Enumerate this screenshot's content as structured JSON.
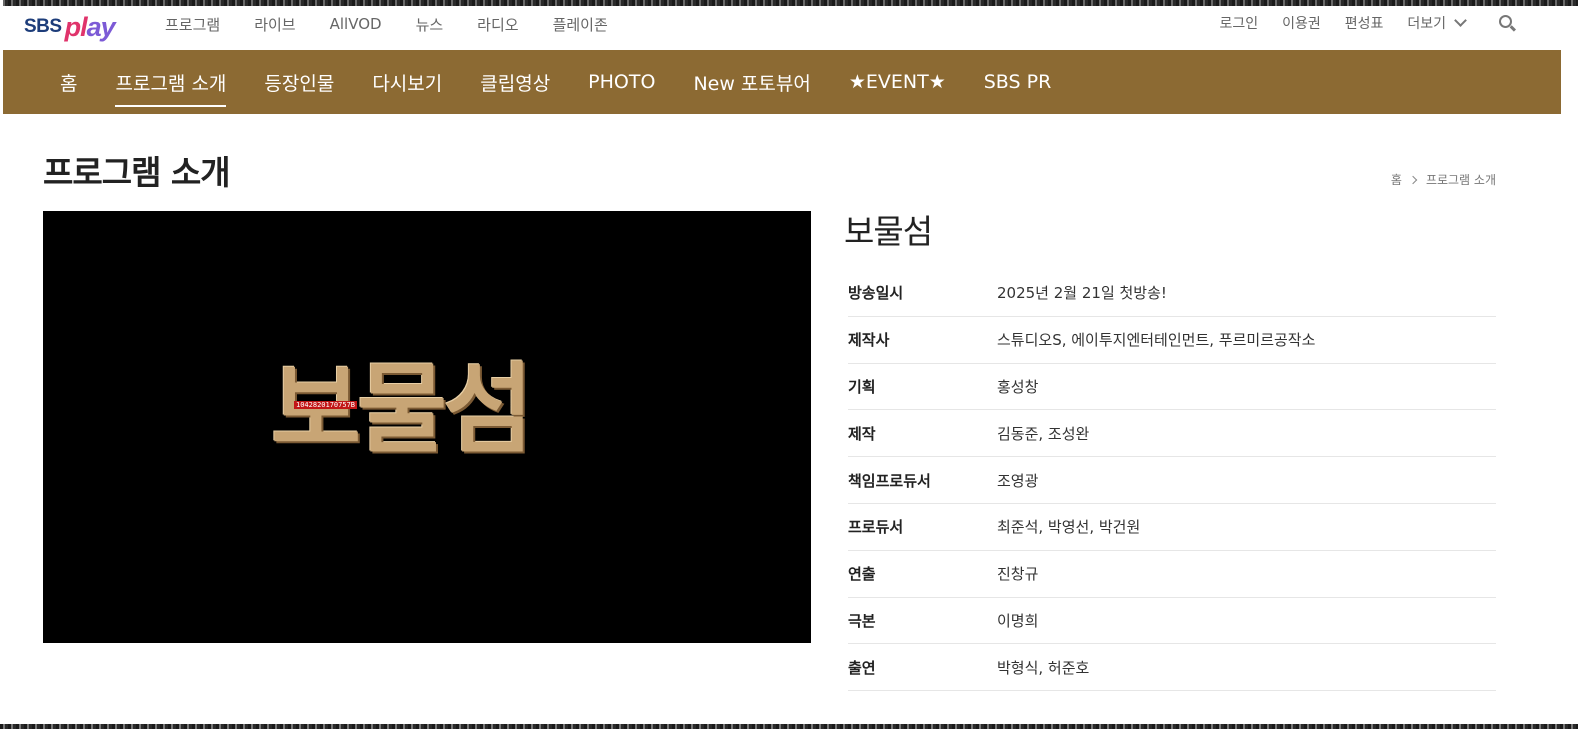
{
  "logo": {
    "sbs": "SBS",
    "play": [
      "p",
      "l",
      "a",
      "y"
    ]
  },
  "topnav": {
    "items": [
      "프로그램",
      "라이브",
      "AllVOD",
      "뉴스",
      "라디오",
      "플레이존"
    ]
  },
  "utility": {
    "login": "로그인",
    "subscription": "이용권",
    "schedule": "편성표",
    "more": "더보기"
  },
  "mainnav": {
    "items": [
      "홈",
      "프로그램 소개",
      "등장인물",
      "다시보기",
      "클립영상",
      "PHOTO",
      "New 포토뷰어",
      "★EVENT★",
      "SBS PR"
    ],
    "active_index": 1
  },
  "page": {
    "title": "프로그램 소개"
  },
  "breadcrumb": {
    "home": "홈",
    "current": "프로그램 소개"
  },
  "poster": {
    "title": "보물섬",
    "code": "1042820170757B"
  },
  "show": {
    "title": "보물섬",
    "info": [
      {
        "label": "방송일시",
        "value": "2025년 2월 21일 첫방송!"
      },
      {
        "label": "제작사",
        "value": "스튜디오S, 에이투지엔터테인먼트, 푸르미르공작소"
      },
      {
        "label": "기획",
        "value": "홍성창"
      },
      {
        "label": "제작",
        "value": "김동준, 조성완"
      },
      {
        "label": "책임프로듀서",
        "value": "조영광"
      },
      {
        "label": "프로듀서",
        "value": "최준석, 박영선, 박건원"
      },
      {
        "label": "연출",
        "value": "진창규"
      },
      {
        "label": "극본",
        "value": "이명희"
      },
      {
        "label": "출연",
        "value": "박형식, 허준호"
      }
    ]
  },
  "colors": {
    "nav_background": "#8c6a33",
    "logo_blue": "#1d3d7a",
    "logo_pink": "#e0336b",
    "logo_purple": "#7c5ad6"
  }
}
